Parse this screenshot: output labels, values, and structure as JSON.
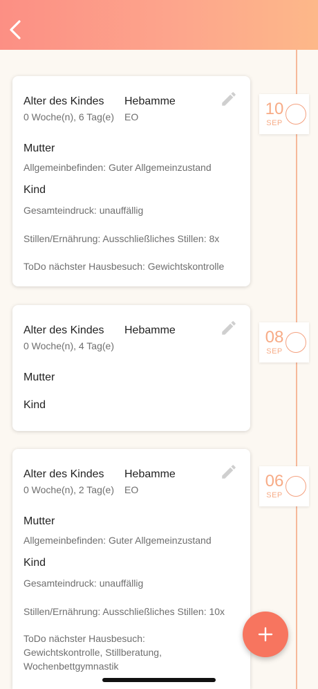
{
  "header": {
    "back_icon": "chevron-left-icon"
  },
  "entries": [
    {
      "date": {
        "day": "10",
        "month": "SEP"
      },
      "age_label": "Alter des Kindes",
      "age_value": "0 Woche(n), 6 Tag(e)",
      "midwife_label": "Hebamme",
      "midwife_value": "EO",
      "mother_label": "Mutter",
      "mother_detail": "Allgemeinbefinden: Guter Allgemeinzustand",
      "child_label": "Kind",
      "child_details": [
        "Gesamteindruck: unauffällig",
        "Stillen/Ernährung: Ausschließliches Stillen: 8x",
        "ToDo nächster Hausbesuch: Gewichtskontrolle"
      ]
    },
    {
      "date": {
        "day": "08",
        "month": "SEP"
      },
      "age_label": "Alter des Kindes",
      "age_value": "0 Woche(n), 4 Tag(e)",
      "midwife_label": "Hebamme",
      "mother_label": "Mutter",
      "child_label": "Kind"
    },
    {
      "date": {
        "day": "06",
        "month": "SEP"
      },
      "age_label": "Alter des Kindes",
      "age_value": "0 Woche(n), 2 Tag(e)",
      "midwife_label": "Hebamme",
      "midwife_value": "EO",
      "mother_label": "Mutter",
      "mother_detail": "Allgemeinbefinden: Guter Allgemeinzustand",
      "child_label": "Kind",
      "child_details": [
        "Gesamteindruck: unauffällig",
        "Stillen/Ernährung: Ausschließliches Stillen: 10x",
        "ToDo nächster Hausbesuch: Gewichtskontrolle, Stillberatung, Wochenbettgymnastik"
      ]
    }
  ],
  "fab": {
    "icon": "plus-icon"
  },
  "colors": {
    "header_gradient_start": "#fc8f84",
    "header_gradient_end": "#fdb889",
    "accent": "#f7ab86",
    "fab": "#f7755f"
  }
}
